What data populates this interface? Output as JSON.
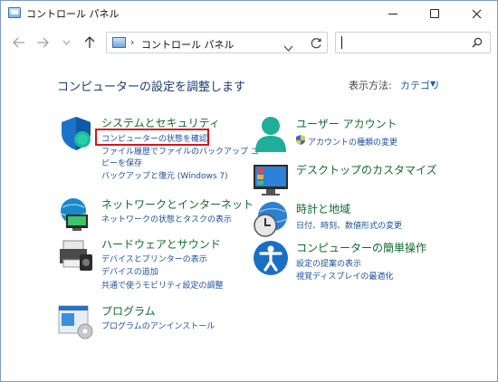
{
  "window": {
    "title": "コントロール パネル"
  },
  "toolbar": {
    "address_text": "コントロール パネル",
    "address_separator": "›",
    "search_placeholder": ""
  },
  "main": {
    "heading": "コンピューターの設定を調整します",
    "view_by_label": "表示方法:",
    "view_by_value": "カテゴリ"
  },
  "categories": [
    {
      "title": "システムとセキュリティ",
      "links": [
        "コンピューターの状態を確認",
        "ファイル履歴でファイルのバックアップ コ",
        "ピーを保存",
        "バックアップと復元 (Windows 7)"
      ]
    },
    {
      "title": "ネットワークとインターネット",
      "links": [
        "ネットワークの状態とタスクの表示"
      ]
    },
    {
      "title": "ハードウェアとサウンド",
      "links": [
        "デバイスとプリンターの表示",
        "デバイスの追加",
        "共通で使うモビリティ設定の調整"
      ]
    },
    {
      "title": "プログラム",
      "links": [
        "プログラムのアンインストール"
      ]
    },
    {
      "title": "ユーザー アカウント",
      "links": [
        "アカウントの種類の変更"
      ]
    },
    {
      "title": "デスクトップのカスタマイズ",
      "links": []
    },
    {
      "title": "時計と地域",
      "links": [
        "日付、時刻、数値形式の変更"
      ]
    },
    {
      "title": "コンピューターの簡単操作",
      "links": [
        "設定の提案の表示",
        "視覚ディスプレイの最適化"
      ]
    }
  ],
  "colors": {
    "category_title": "#0f6b2e",
    "link": "#1b4f9c",
    "heading": "#1f3a78",
    "highlight_border": "#d8141b"
  },
  "icons": [
    "back-arrow-icon",
    "forward-arrow-icon",
    "chevron-down-icon",
    "up-arrow-icon",
    "refresh-icon",
    "search-icon",
    "shield-icon",
    "network-icon",
    "printer-icon",
    "programs-icon",
    "user-icon",
    "uac-shield-icon",
    "desktop-icon",
    "clock-globe-icon",
    "accessibility-icon"
  ]
}
